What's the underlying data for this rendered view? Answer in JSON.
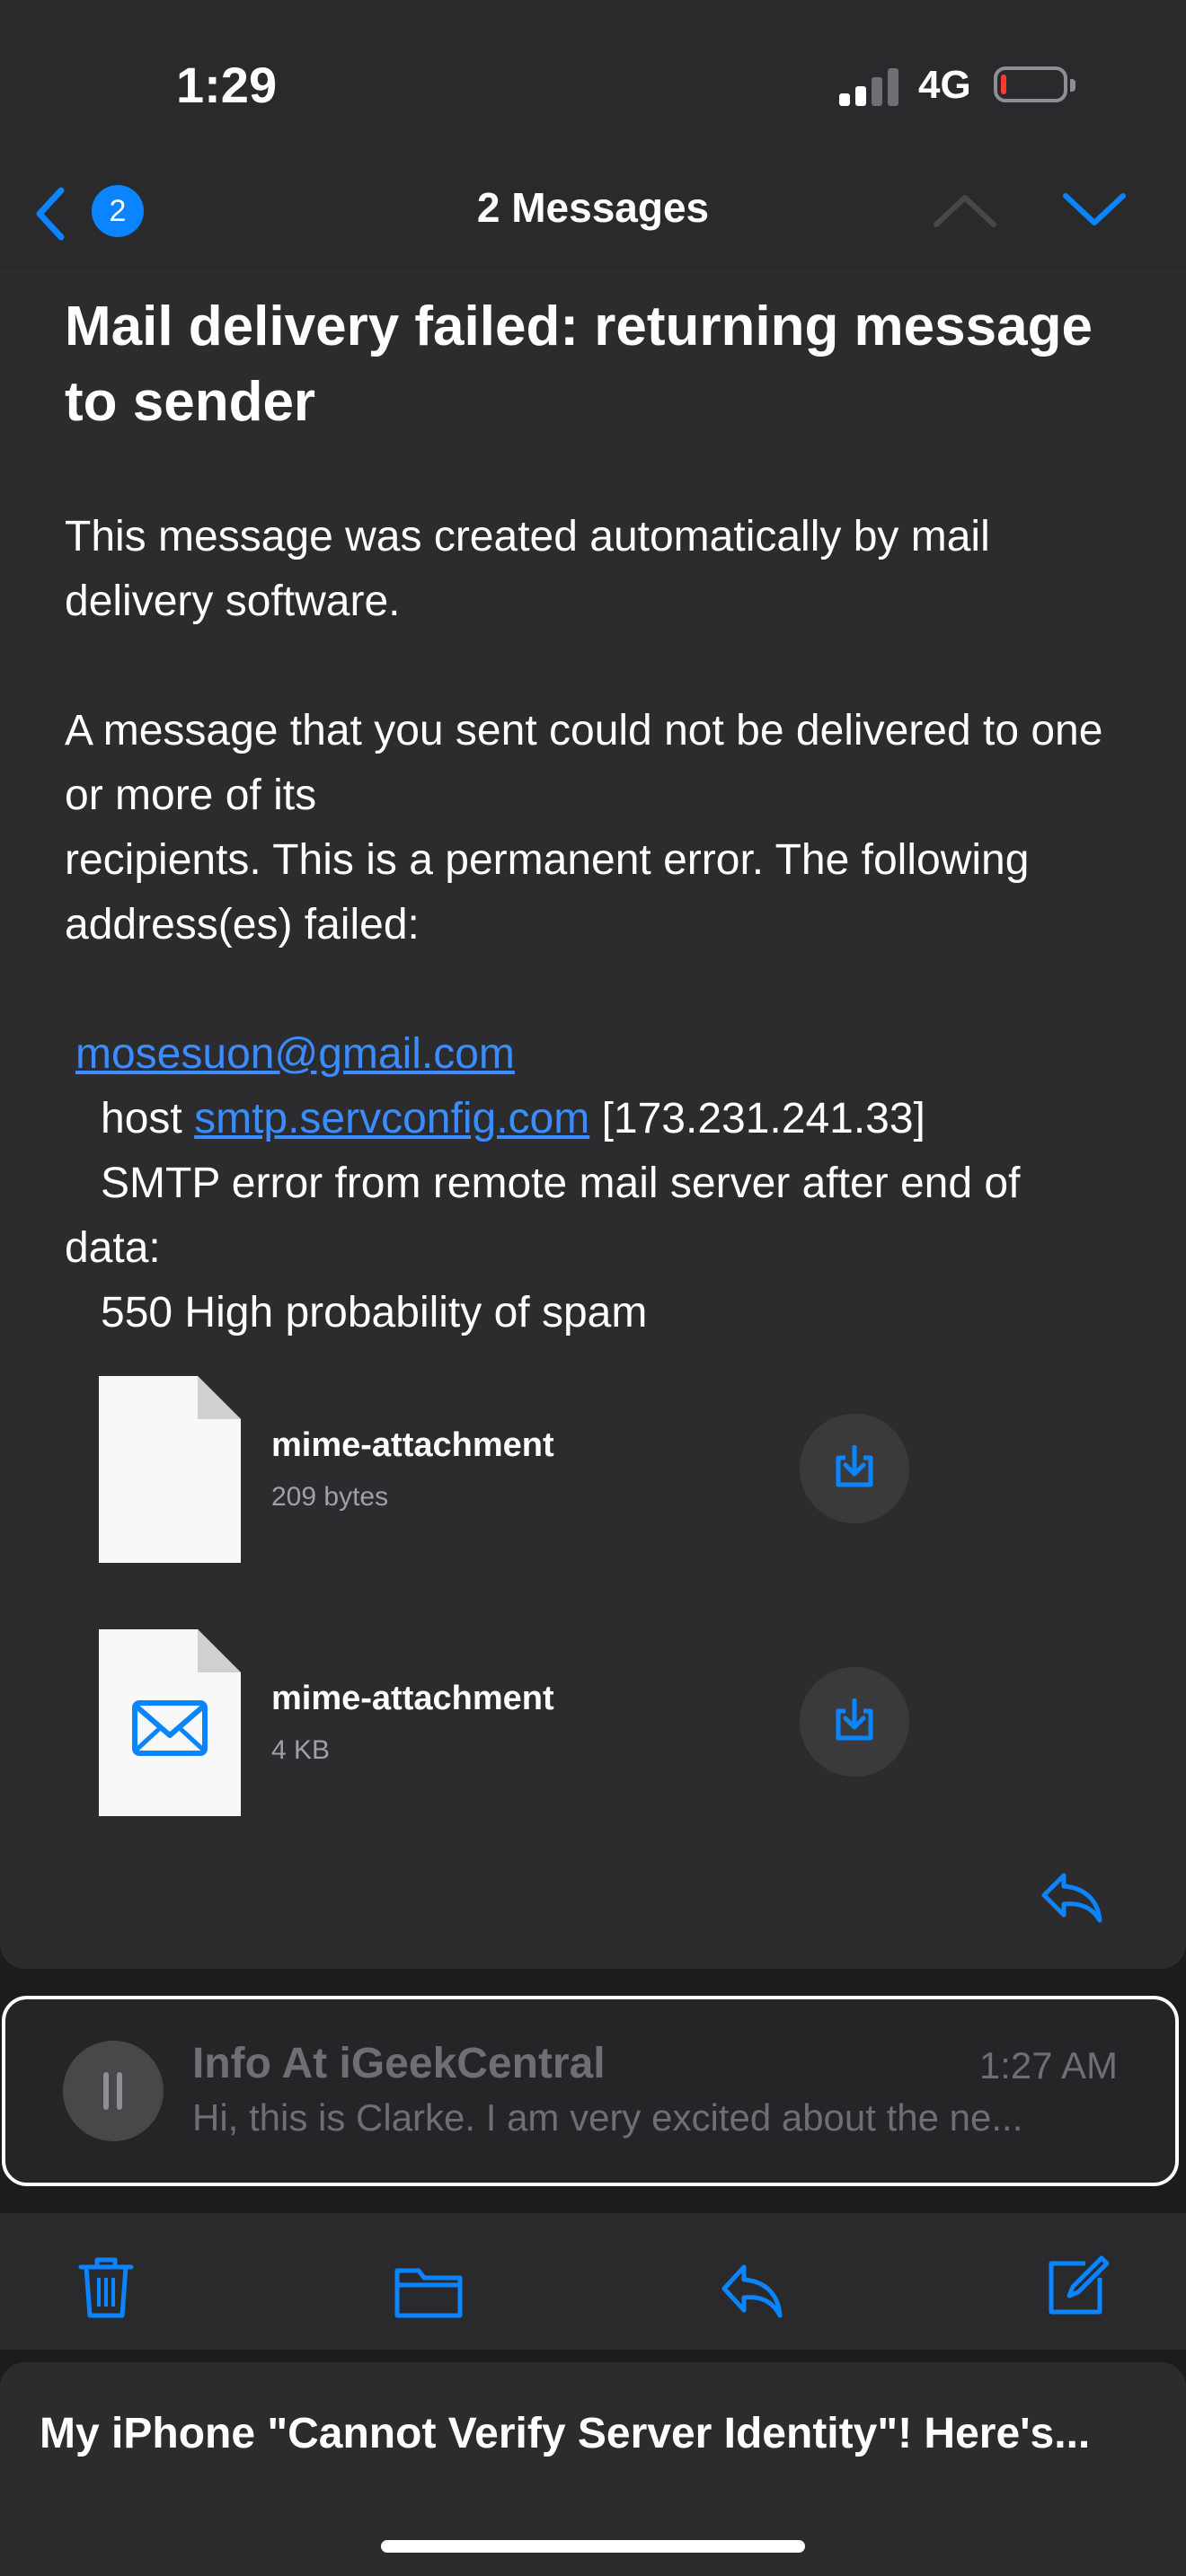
{
  "status_bar": {
    "time": "1:29",
    "network": "4G",
    "signal_bars_active": 2,
    "signal_bars_total": 4,
    "battery_level": "low",
    "battery_color": "#ff3b30"
  },
  "nav": {
    "back_badge": "2",
    "title": "2 Messages"
  },
  "message": {
    "subject": "Mail delivery failed: returning message to sender",
    "para1": "This message was created automatically by mail delivery software.",
    "para2_line1": "A message that you sent could not be delivered to one or more of its",
    "para2_line2": "recipients. This is a permanent error. The following address(es) failed:",
    "failed_address": "mosesuon@gmail.com",
    "host_prefix": "host",
    "host_link": "smtp.servconfig.com",
    "host_ip": "[173.231.241.33]",
    "smtp_error": "SMTP error from remote mail server after end of data:",
    "spam_line": "550 High probability of spam",
    "attachments": [
      {
        "name": "mime-attachment",
        "size": "209 bytes",
        "icon": "document-icon"
      },
      {
        "name": "mime-attachment",
        "size": "4 KB",
        "icon": "envelope-icon"
      }
    ]
  },
  "collapsed_message": {
    "sender": "Info At iGeekCentral",
    "time": "1:27 AM",
    "preview": "Hi, this is Clarke. I am very excited about the ne..."
  },
  "toolbar": {
    "items": [
      "trash-icon",
      "folder-icon",
      "reply-icon",
      "compose-icon"
    ]
  },
  "banner": {
    "text": "My iPhone \"Cannot Verify Server Identity\"! Here's..."
  },
  "colors": {
    "accent": "#0a84ff",
    "link": "#3a8cff",
    "background": "#1c1c1e",
    "card": "#2c2c2e"
  }
}
